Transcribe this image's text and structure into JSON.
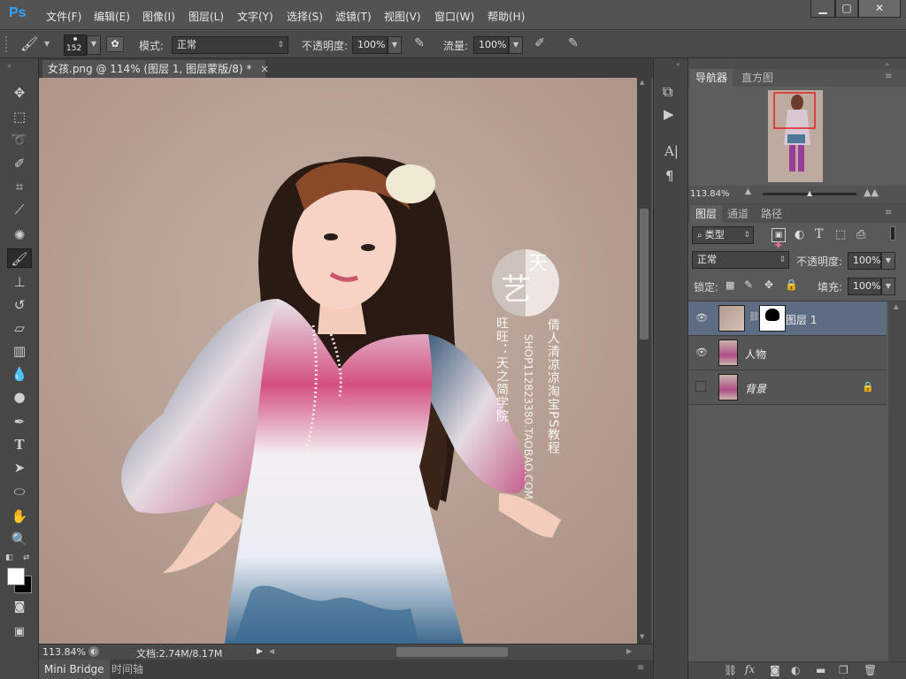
{
  "app": {
    "logo": "Ps"
  },
  "menu": [
    "文件(F)",
    "编辑(E)",
    "图像(I)",
    "图层(L)",
    "文字(Y)",
    "选择(S)",
    "滤镜(T)",
    "视图(V)",
    "窗口(W)",
    "帮助(H)"
  ],
  "window_controls": {
    "minimize": "▁",
    "restore": "▢",
    "close": "✕"
  },
  "options": {
    "brush_size": "152",
    "mode_label": "模式:",
    "mode_value": "正常",
    "opacity_label": "不透明度:",
    "opacity_value": "100%",
    "flow_label": "流量:",
    "flow_value": "100%"
  },
  "document": {
    "tab_title": "女孩.png @ 114% (图层 1, 图层蒙版/8) *",
    "close_glyph": "×",
    "zoom": "113.84%",
    "doc_size": "文档:2.74M/8.17M"
  },
  "watermark": {
    "seal_char": "艺",
    "top_char": "天",
    "col1": "旺旺：天之简学院",
    "col2": "SHOP112823380.TAOBAO.COM",
    "col3": "倩人清凉凉淘宝PS教程"
  },
  "bottom_tabs": [
    "Mini Bridge",
    "时间轴"
  ],
  "navigator": {
    "tabs": [
      "导航器",
      "直方图"
    ],
    "zoom": "113.84%"
  },
  "layers_panel": {
    "tabs": [
      "图层",
      "通道",
      "路径"
    ],
    "filter_kind": "类型",
    "blend_mode": "正常",
    "opacity_label": "不透明度:",
    "opacity_value": "100%",
    "lock_label": "锁定:",
    "fill_label": "填充:",
    "fill_value": "100%",
    "layers": [
      {
        "name": "图层 1",
        "visible": true,
        "selected": true,
        "mask": true
      },
      {
        "name": "人物",
        "visible": true,
        "selected": false,
        "mask": false
      },
      {
        "name": "背景",
        "visible": false,
        "selected": false,
        "mask": false,
        "locked": true
      }
    ]
  },
  "colors": {
    "accent": "#2fa3ff",
    "selected_layer": "#5d6c82",
    "canvas_bg": "#b69f93"
  }
}
